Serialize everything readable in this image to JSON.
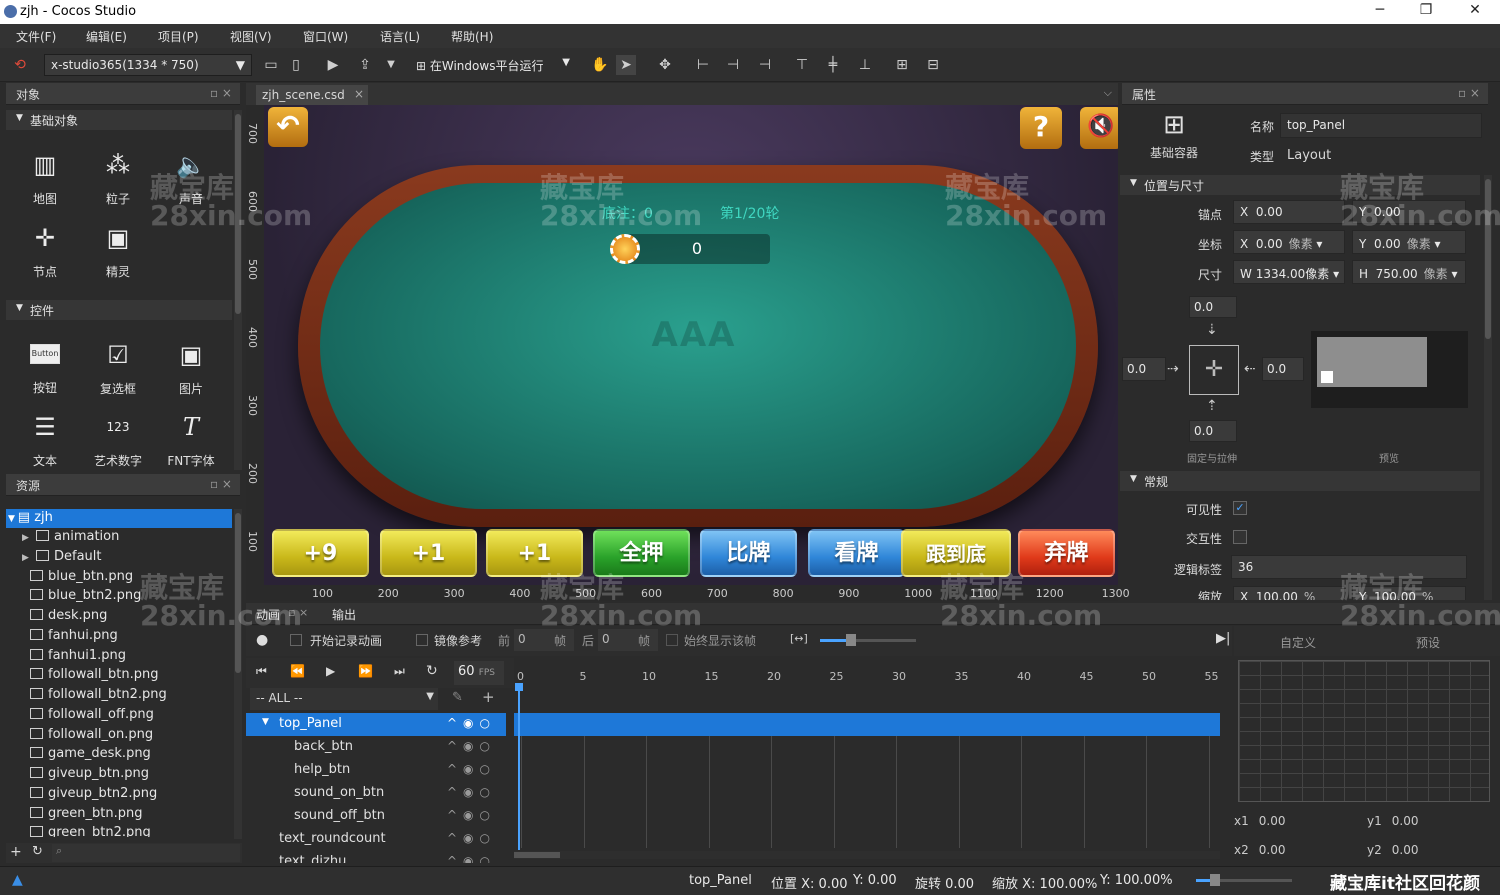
{
  "window": {
    "title": "zjh - Cocos Studio",
    "minimize": "─",
    "restore": "❐",
    "close": "✕"
  },
  "menu": [
    "文件(F)",
    "编辑(E)",
    "项目(P)",
    "视图(V)",
    "窗口(W)",
    "语言(L)",
    "帮助(H)"
  ],
  "toolbar": {
    "resolution": "x-studio365(1334 * 750)",
    "run_label": "在Windows平台运行"
  },
  "objects_panel": {
    "title": "对象",
    "basic_section": "基础对象",
    "basic_items": [
      {
        "label": "地图",
        "icon": "map-icon"
      },
      {
        "label": "粒子",
        "icon": "particle-icon"
      },
      {
        "label": "声音",
        "icon": "sound-icon"
      },
      {
        "label": "节点",
        "icon": "node-icon"
      },
      {
        "label": "精灵",
        "icon": "sprite-icon"
      }
    ],
    "controls_section": "控件",
    "control_items": [
      {
        "label": "按钮",
        "icon": "button-icon",
        "glyph": "Button"
      },
      {
        "label": "复选框",
        "icon": "checkbox-icon"
      },
      {
        "label": "图片",
        "icon": "image-icon"
      },
      {
        "label": "文本",
        "icon": "text-icon"
      },
      {
        "label": "艺术数字",
        "icon": "atlas-number-icon",
        "glyph": "123"
      },
      {
        "label": "FNT字体",
        "icon": "fnt-font-icon",
        "glyph": "T"
      }
    ]
  },
  "resources_panel": {
    "title": "资源",
    "root": "zjh",
    "items": [
      "animation",
      "Default",
      "blue_btn.png",
      "blue_btn2.png",
      "desk.png",
      "fanhui.png",
      "fanhui1.png",
      "followall_btn.png",
      "followall_btn2.png",
      "followall_off.png",
      "followall_on.png",
      "game_desk.png",
      "giveup_btn.png",
      "giveup_btn2.png",
      "green_btn.png",
      "green_btn2.png"
    ]
  },
  "scene": {
    "tab": "zjh_scene.csd",
    "pot_label": "底注：0",
    "round_label": "第1/20轮",
    "chip_total": "0",
    "table_logo": "AAA",
    "buttons": [
      "+9",
      "+1",
      "+1",
      "全押",
      "比牌",
      "看牌",
      "跟到底",
      "弃牌"
    ],
    "ruler_x": [
      "100",
      "200",
      "300",
      "400",
      "500",
      "600",
      "700",
      "800",
      "900",
      "1000",
      "1100",
      "1200",
      "1300"
    ],
    "ruler_y": [
      "700",
      "600",
      "500",
      "400",
      "300",
      "200",
      "100"
    ],
    "help_glyph": "?"
  },
  "properties": {
    "title": "属性",
    "container_label": "基础容器",
    "name_label": "名称",
    "name_value": "top_Panel",
    "type_label": "类型",
    "type_value": "Layout",
    "pos_section": "位置与尺寸",
    "anchor_label": "锚点",
    "anchor_x": "0.00",
    "anchor_y": "0.00",
    "pos_label": "坐标",
    "pos_x": "0.00",
    "pos_y": "0.00",
    "unit_px": "像素",
    "size_label": "尺寸",
    "size_w": "1334.00像素",
    "size_h": "750.00",
    "margin_top": "0.0",
    "margin_left": "0.0",
    "margin_right": "0.0",
    "margin_bottom": "0.0",
    "fix_label": "固定与拉伸",
    "preview_label": "预览",
    "general_section": "常规",
    "visible_label": "可见性",
    "interactive_label": "交互性",
    "tag_label": "逻辑标签",
    "tag_value": "36",
    "scale_label": "缩放",
    "scale_x": "100.00",
    "scale_y": "100.00",
    "percent": "%"
  },
  "timeline": {
    "tab_anim": "动画",
    "tab_output": "输出",
    "record_label": "开始记录动画",
    "mirror_label": "镜像参考",
    "prev_label": "前",
    "prev_val": "0",
    "frame_label": "帧",
    "next_label": "后",
    "next_val": "0",
    "always_label": "始终显示该帧",
    "fps": "60",
    "fps_unit": "FPS",
    "filter": "-- ALL --",
    "frames": [
      "0",
      "5",
      "10",
      "15",
      "20",
      "25",
      "30",
      "35",
      "40",
      "45",
      "50",
      "55"
    ],
    "nodes": [
      "top_Panel",
      "back_btn",
      "help_btn",
      "sound_on_btn",
      "sound_off_btn",
      "text_roundcount",
      "text_dizhu"
    ],
    "custom_label": "自定义",
    "preset_label": "预设",
    "x1": "0.00",
    "y1": "0.00",
    "x2": "0.00",
    "y2": "0.00",
    "x1_label": "x1",
    "y1_label": "y1",
    "x2_label": "x2",
    "y2_label": "y2"
  },
  "statusbar": {
    "node": "top_Panel",
    "position": "位置 X: 0.00",
    "position_y": "Y: 0.00",
    "rotation": "旋转 0.00",
    "scale": "缩放 X: 100.00%",
    "scale_y": "Y: 100.00%"
  },
  "watermark": [
    "藏宝库",
    "28xin.com"
  ],
  "footer_watermark": "藏宝库it社区回花颜",
  "colors": {
    "selection": "#1e78d8",
    "felt": "#1d7a6e",
    "panel": "#2b2b2b"
  }
}
